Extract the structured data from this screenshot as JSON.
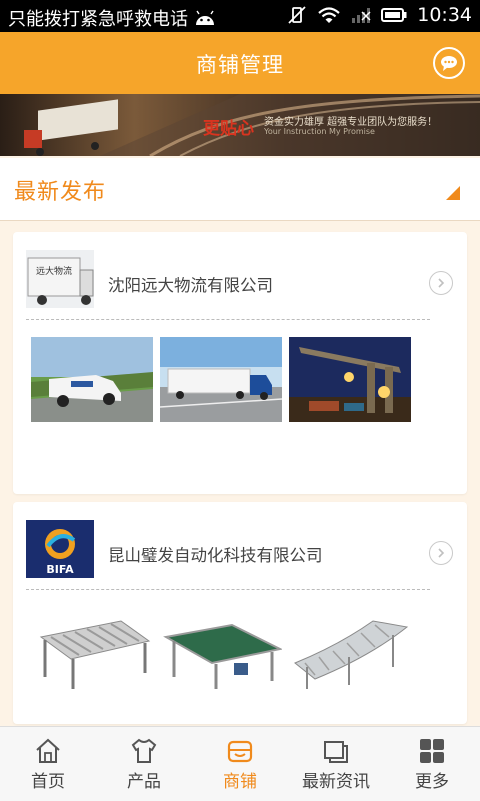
{
  "statusbar": {
    "notification_text": "只能拨打紧急呼救电话",
    "time": "10:34"
  },
  "header": {
    "title": "商铺管理",
    "message_icon": "chat-bubble-icon"
  },
  "banner": {
    "slogan": "更贴心",
    "sub1": "资金实力雄厚  超强专业团队为您服务！",
    "sub2": "Your Instruction My Promise"
  },
  "section": {
    "title": "最新发布"
  },
  "shops": [
    {
      "name": "沈阳远大物流有限公司",
      "logo_text": "远大物流"
    },
    {
      "name": "昆山璧发自动化科技有限公司",
      "logo_text": "BIFA"
    }
  ],
  "tabs": [
    {
      "label": "首页",
      "icon": "home-icon"
    },
    {
      "label": "产品",
      "icon": "shirt-icon"
    },
    {
      "label": "商铺",
      "icon": "shop-icon",
      "active": true
    },
    {
      "label": "最新资讯",
      "icon": "news-icon"
    },
    {
      "label": "更多",
      "icon": "grid-icon"
    }
  ],
  "colors": {
    "accent": "#f6a52a",
    "active": "#f08a1c"
  }
}
